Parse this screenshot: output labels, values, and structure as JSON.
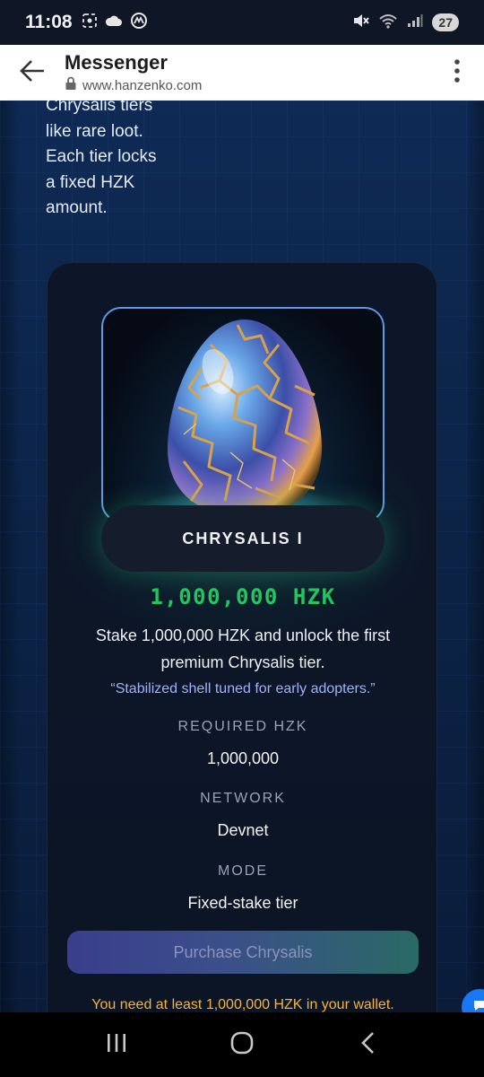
{
  "status_bar": {
    "time": "11:08",
    "battery": "27",
    "left_icons": [
      "screenshot-icon",
      "cloud-icon",
      "app-notification-icon"
    ],
    "right_icons": [
      "mute-icon",
      "wifi-icon",
      "signal-icon"
    ]
  },
  "browser": {
    "title": "Messenger",
    "url": "www.hanzenko.com",
    "icons": [
      "back-arrow-icon",
      "lock-icon",
      "more-vert-icon"
    ]
  },
  "page": {
    "intro_lines": [
      "Chrysalis tiers",
      "like rare loot.",
      "Each tier locks",
      "a fixed HZK",
      "amount."
    ],
    "card": {
      "tier_name": "CHRYSALIS I",
      "price": "1,000,000 HZK",
      "description": "Stake 1,000,000 HZK and unlock the first premium Chrysalis tier.",
      "quote": "“Stabilized shell tuned for early adopters.”",
      "fields": [
        {
          "label": "REQUIRED HZK",
          "value": "1,000,000"
        },
        {
          "label": "NETWORK",
          "value": "Devnet"
        },
        {
          "label": "MODE",
          "value": "Fixed-stake tier"
        }
      ],
      "button_label": "Purchase Chrysalis",
      "warning": "You need at least 1,000,000 HZK in your wallet."
    }
  },
  "colors": {
    "accent_green": "#22c55e",
    "quote_blue": "#9fb3ff",
    "warning_amber": "#f5b53b",
    "frame_blue": "#5b9be6"
  },
  "nav": [
    "recents-icon",
    "home-icon",
    "back-icon"
  ]
}
